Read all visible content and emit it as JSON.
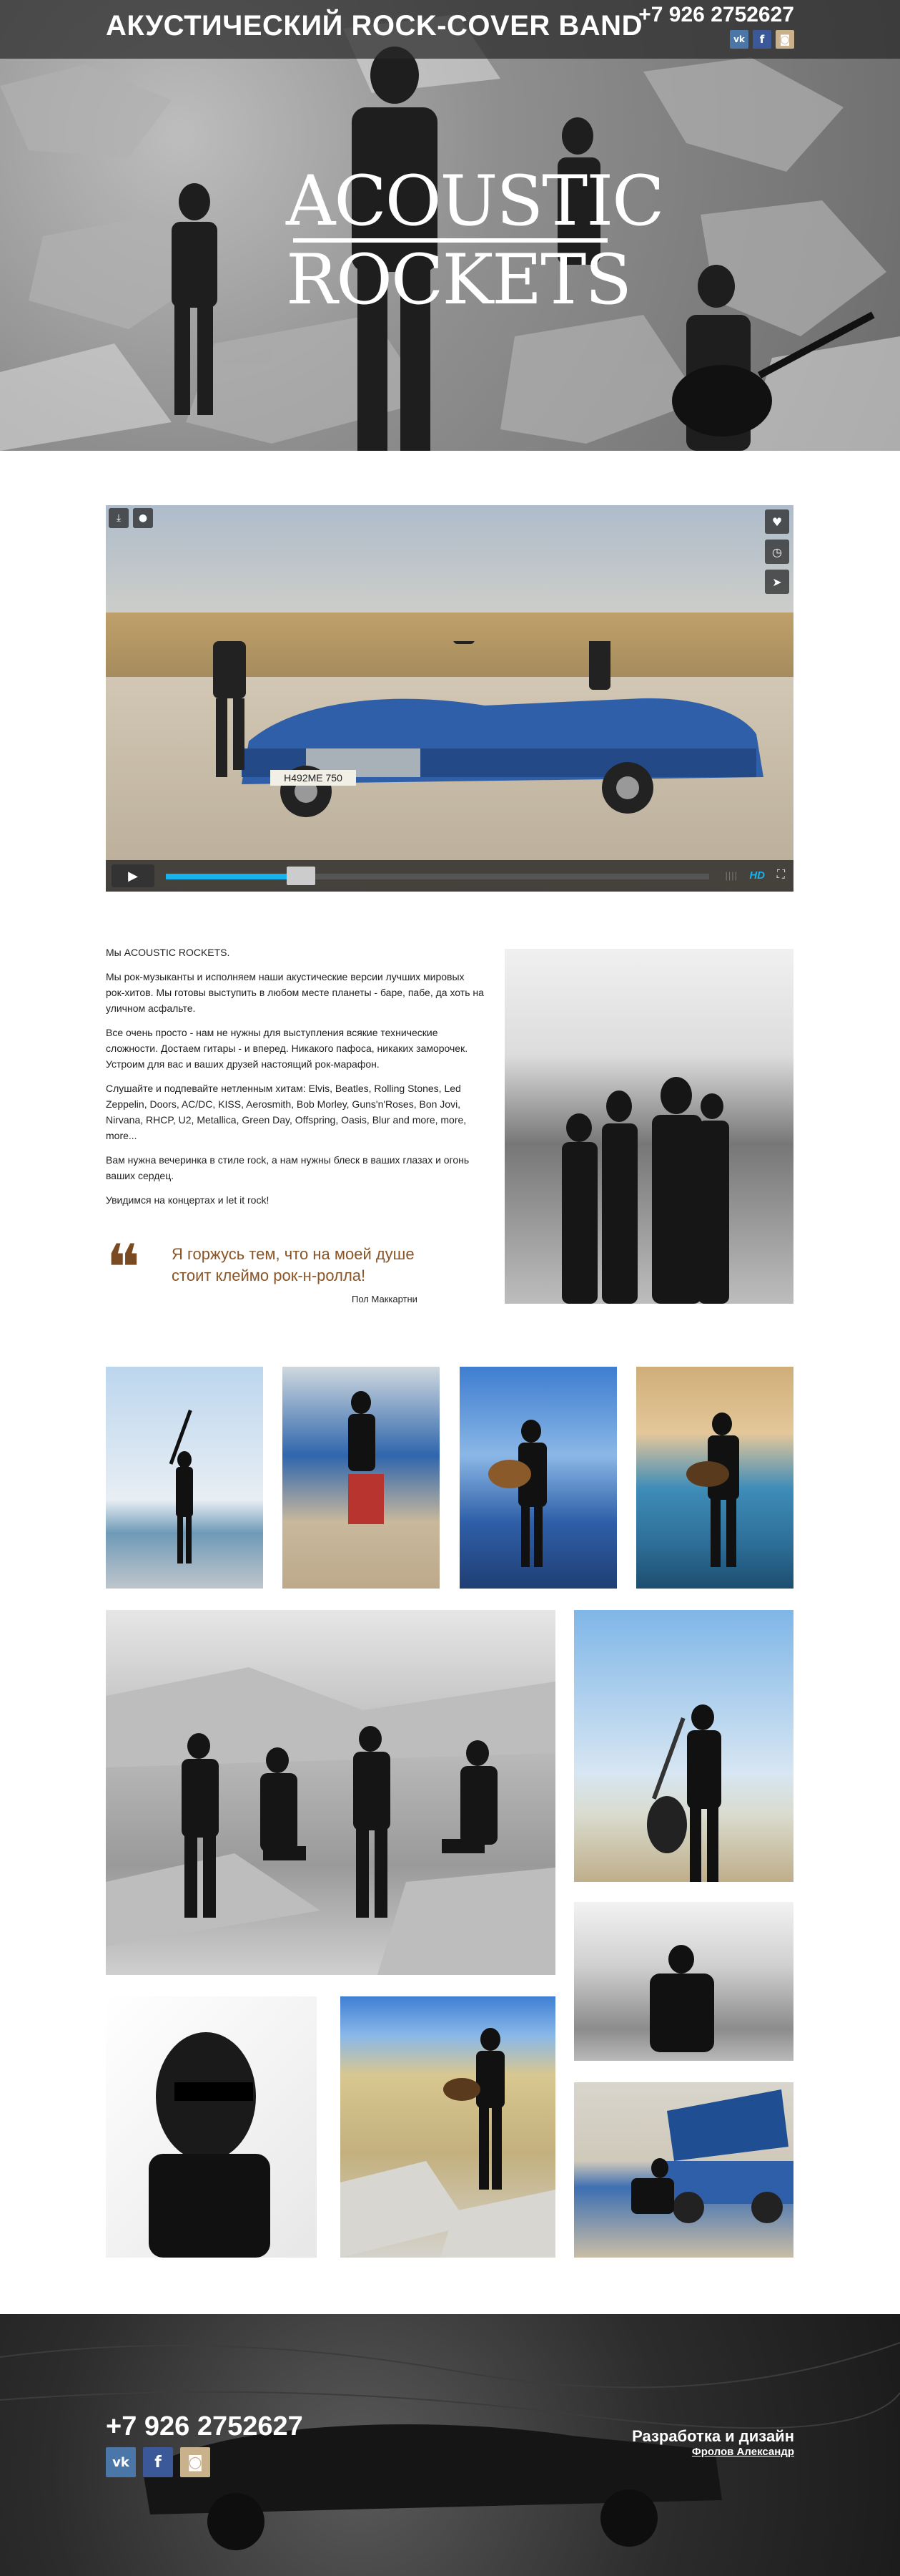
{
  "header": {
    "site_title": "АКУСТИЧЕСКИЙ ROCK-COVER BAND",
    "phone": "+7 926 2752627",
    "socials": [
      {
        "name": "vk",
        "label": "vk",
        "color": "#4a76a8"
      },
      {
        "name": "facebook",
        "label": "f",
        "color": "#3b5998"
      },
      {
        "name": "instagram",
        "label": "◙",
        "color": "#c9b18c"
      }
    ]
  },
  "hero": {
    "logo_line1": "ACOUSTIC",
    "logo_line2": "ROCKETS"
  },
  "video": {
    "plate": "Н492МЕ 750",
    "progress_fraction": 0.23,
    "hd_label": "HD",
    "left_icons": [
      "download-icon",
      "lightbulb-icon"
    ],
    "right_icons": [
      "heart-icon",
      "clock-icon",
      "send-icon"
    ]
  },
  "about": {
    "intro": "Мы ACOUSTIC ROCKETS.",
    "p1": "Мы рок-музыканты и исполняем наши акустические версии лучших мировых рок-хитов. Мы готовы выступить в любом месте планеты - баре, пабе, да хоть на уличном асфальте.",
    "p2": "Все очень просто - нам не нужны для выступления всякие технические сложности. Достаем гитары - и вперед. Никакого пафоса, никаких заморочек. Устроим для вас и ваших друзей настоящий рок-марафон.",
    "p3": "Слушайте и подпевайте нетленным хитам: Elvis, Beatles, Rolling Stones, Led Zeppelin, Doors, AC/DC, KISS, Aerosmith, Bob Morley, Guns'n'Roses, Bon Jovi, Nirvana, RHCP, U2, Metallica, Green Day, Offspring, Oasis, Blur and more, more, more...",
    "p4": "Вам нужна вечеринка в стиле rock, а нам нужны блеск в ваших глазах и огонь ваших сердец.",
    "p5": "Увидимся на концертах и let it rock!"
  },
  "quote": {
    "mark": "❝",
    "text": "Я горжусь тем, что на моей душе стоит клеймо рок-н-ролла!",
    "author": "Пол Маккартни"
  },
  "footer": {
    "phone": "+7 926 2752627",
    "credit_title": "Разработка и дизайн",
    "credit_link": "Фролов Александр",
    "socials": [
      {
        "name": "vk",
        "label": "vk"
      },
      {
        "name": "facebook",
        "label": "f"
      },
      {
        "name": "instagram",
        "label": "◙"
      }
    ]
  },
  "colors": {
    "accent_blue": "#18b3ec",
    "quote_brown": "#8a5526",
    "car_blue": "#2f5fa8"
  }
}
